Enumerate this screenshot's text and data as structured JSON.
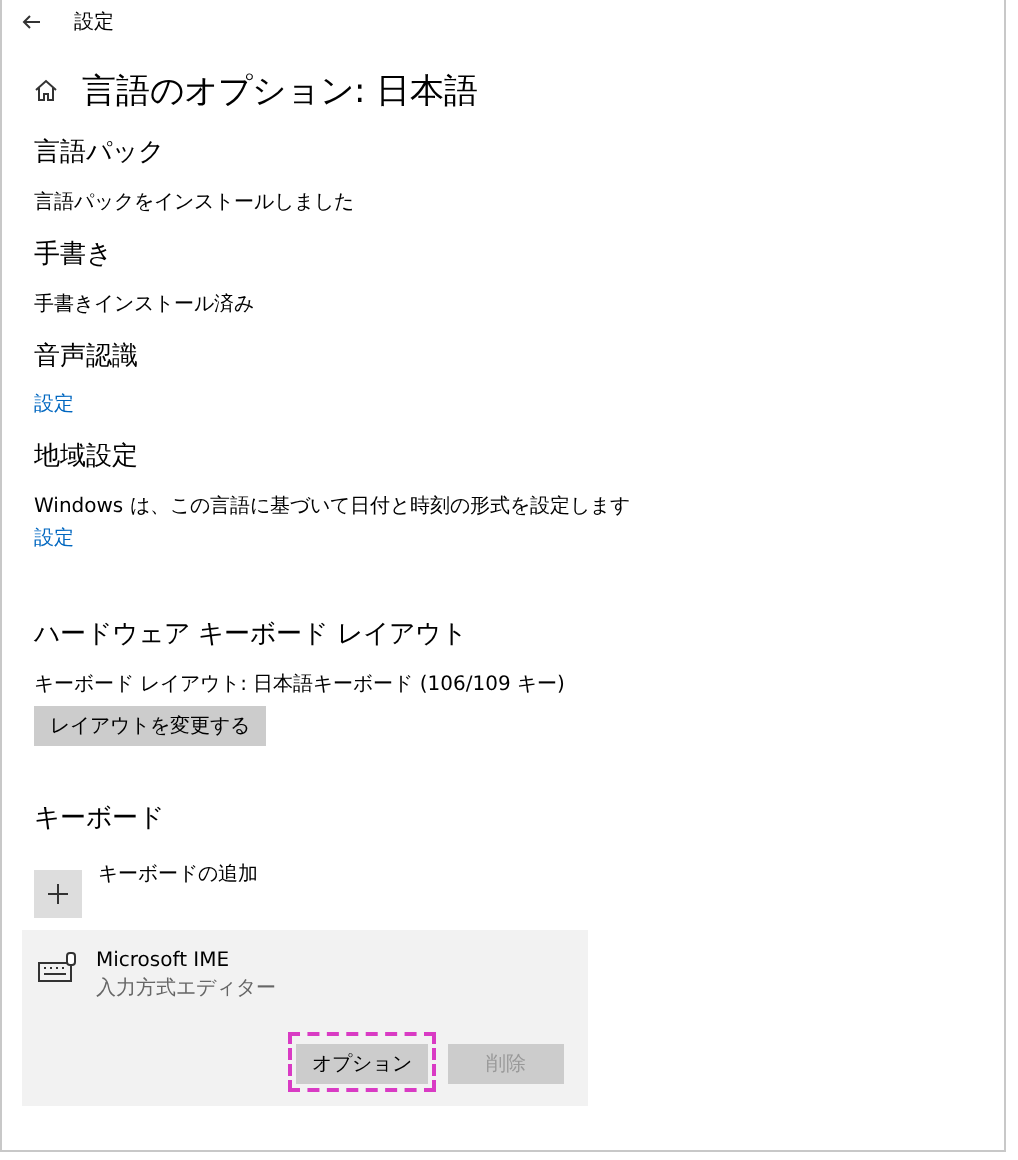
{
  "window": {
    "title": "設定"
  },
  "page_title": "言語のオプション: 日本語",
  "sections": [
    {
      "kind": "text",
      "heading": "言語パック",
      "text": "言語パックをインストールしました"
    },
    {
      "kind": "text",
      "heading": "手書き",
      "text": "手書きインストール済み"
    },
    {
      "kind": "link",
      "heading": "音声認識",
      "link": "設定"
    },
    {
      "kind": "textlink",
      "heading": "地域設定",
      "text": "Windows は、この言語に基づいて日付と時刻の形式を設定します",
      "link": "設定"
    },
    {
      "kind": "button",
      "heading": "ハードウェア キーボード レイアウト",
      "text": "キーボード レイアウト:  日本語キーボード (106/109 キー)",
      "button": "レイアウトを変更する"
    }
  ],
  "keyboard": {
    "heading": "キーボード",
    "add_label": "キーボードの追加",
    "items": [
      {
        "name": "Microsoft IME",
        "description": "入力方式エディター",
        "selected": true,
        "buttons": [
          {
            "label": "オプション",
            "disabled": false,
            "highlighted": true
          },
          {
            "label": "削除",
            "disabled": true,
            "highlighted": false
          }
        ]
      }
    ]
  }
}
